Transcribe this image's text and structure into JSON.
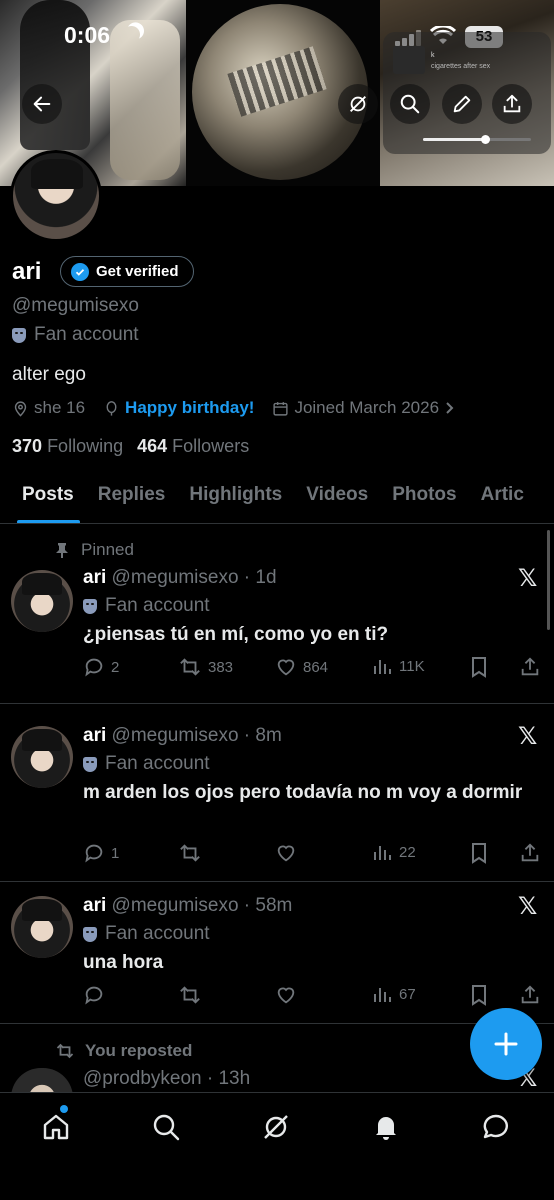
{
  "status_bar": {
    "time": "0:06",
    "battery": "53"
  },
  "media_widget": {
    "title": "k",
    "subtitle": "cigarettes after sex"
  },
  "profile": {
    "name": "ari",
    "get_verified_label": "Get verified",
    "handle": "@megumisexo",
    "category": "Fan account",
    "bio": "alter ego",
    "location": "she 16",
    "birthday": "Happy birthday!",
    "joined": "Joined March 2026",
    "following_count": "370",
    "following_label": "Following",
    "followers_count": "464",
    "followers_label": "Followers"
  },
  "tabs": [
    "Posts",
    "Replies",
    "Highlights",
    "Videos",
    "Photos",
    "Artic"
  ],
  "pinned_label": "Pinned",
  "posts": [
    {
      "name": "ari",
      "handle_time": "@megumisexo · 1d",
      "category": "Fan account",
      "text": "¿piensas tú en mí, como yo en ti?",
      "replies": "2",
      "reposts": "383",
      "likes": "864",
      "views": "11K"
    },
    {
      "name": "ari",
      "handle_time": "@megumisexo · 8m",
      "category": "Fan account",
      "text": "m arden los ojos pero todavía no m voy a dormir",
      "replies": "1",
      "reposts": "",
      "likes": "",
      "views": "22"
    },
    {
      "name": "ari",
      "handle_time": "@megumisexo · 58m",
      "category": "Fan account",
      "text": "una hora",
      "replies": "",
      "reposts": "",
      "likes": "",
      "views": "67"
    }
  ],
  "repost_label": "You reposted",
  "partial_post": {
    "handle_time": "@prodbykeon · 13h"
  },
  "x_logo": "𝕏",
  "colors": {
    "accent": "#1d9bf0",
    "muted": "#71767b",
    "background": "#000000",
    "text": "#e7e9ea"
  }
}
